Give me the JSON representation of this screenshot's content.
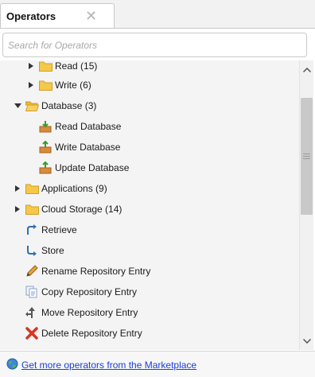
{
  "tab": {
    "title": "Operators",
    "close_glyph": "✕"
  },
  "search": {
    "placeholder": "Search for Operators",
    "value": ""
  },
  "tree": [
    {
      "label": "Read (15)",
      "type": "folder",
      "state": "collapsed",
      "indent": 1,
      "icon": "folder-icon"
    },
    {
      "label": "Write (6)",
      "type": "folder",
      "state": "collapsed",
      "indent": 1,
      "icon": "folder-icon"
    },
    {
      "label": "Database (3)",
      "type": "folder",
      "state": "expanded",
      "indent": 0,
      "icon": "folder-open-icon"
    },
    {
      "label": "Read Database",
      "type": "operator",
      "indent": 1,
      "icon": "read-database-icon"
    },
    {
      "label": "Write Database",
      "type": "operator",
      "indent": 1,
      "icon": "write-database-icon"
    },
    {
      "label": "Update Database",
      "type": "operator",
      "indent": 1,
      "icon": "update-database-icon"
    },
    {
      "label": "Applications (9)",
      "type": "folder",
      "state": "collapsed",
      "indent": 0,
      "icon": "folder-icon"
    },
    {
      "label": "Cloud Storage (14)",
      "type": "folder",
      "state": "collapsed",
      "indent": 0,
      "icon": "folder-icon"
    },
    {
      "label": "Retrieve",
      "type": "operator",
      "indent": 0,
      "icon": "retrieve-icon"
    },
    {
      "label": "Store",
      "type": "operator",
      "indent": 0,
      "icon": "store-icon"
    },
    {
      "label": "Rename Repository Entry",
      "type": "operator",
      "indent": 0,
      "icon": "pencil-icon"
    },
    {
      "label": "Copy Repository Entry",
      "type": "operator",
      "indent": 0,
      "icon": "copy-icon"
    },
    {
      "label": "Move Repository Entry",
      "type": "operator",
      "indent": 0,
      "icon": "move-icon"
    },
    {
      "label": "Delete Repository Entry",
      "type": "operator",
      "indent": 0,
      "icon": "delete-icon"
    }
  ],
  "footer": {
    "link_text": "Get more operators from the Marketplace",
    "icon": "globe-icon"
  },
  "colors": {
    "folder": "#f5c84a",
    "folder_edge": "#d39f22",
    "link": "#1a3fd6",
    "delete": "#d9341f"
  }
}
